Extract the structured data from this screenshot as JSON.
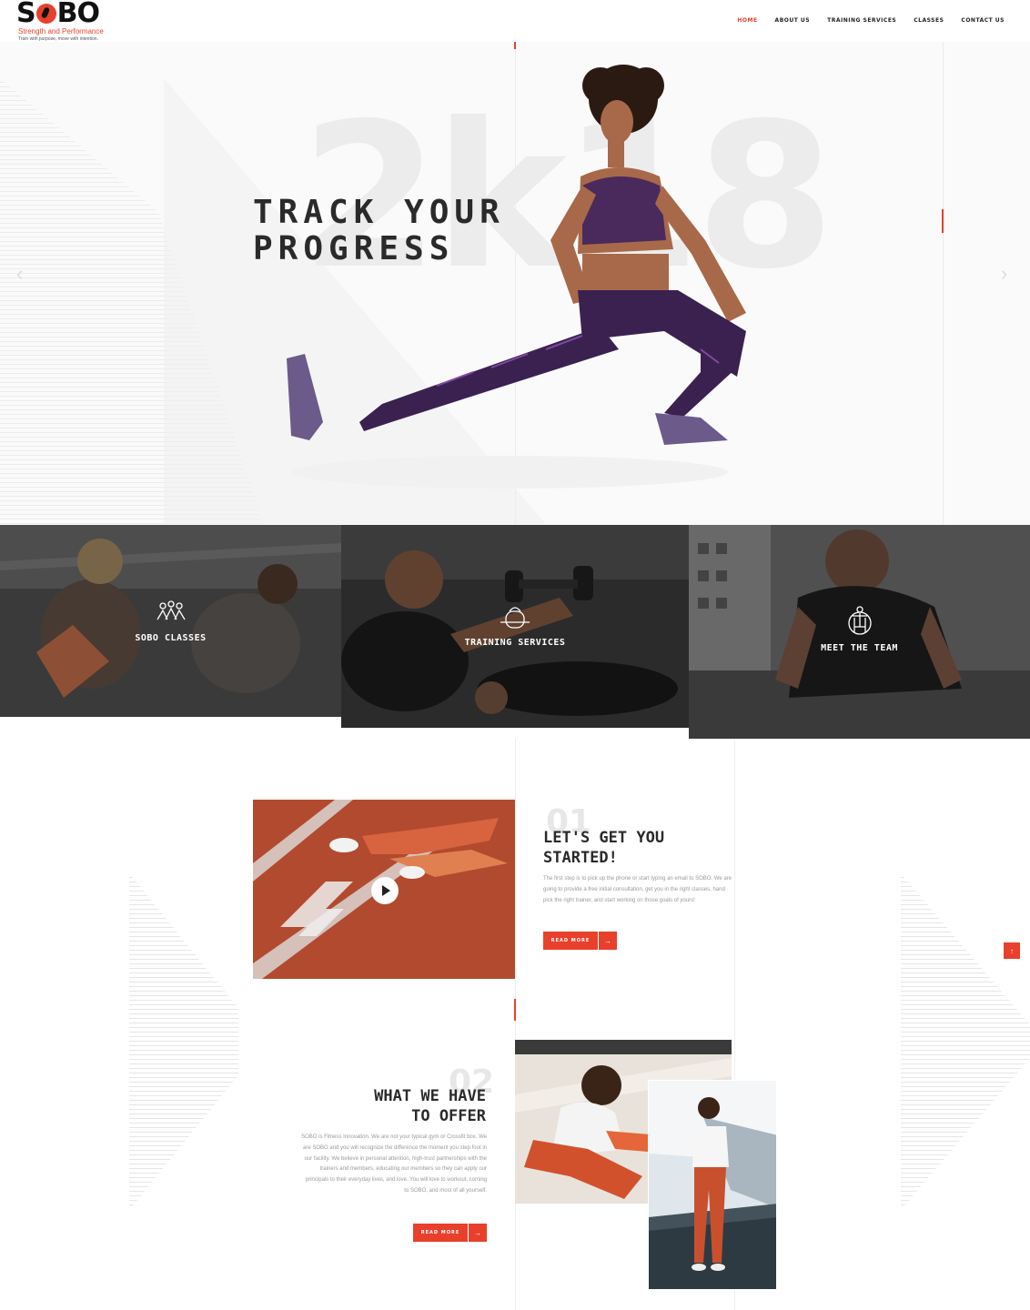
{
  "brand": {
    "name_left": "S",
    "name_right": "BO",
    "tagline": "Strength and Performance",
    "subtitle": "Train with purpose, move with intention."
  },
  "nav": {
    "items": [
      "HOME",
      "ABOUT US",
      "TRAINING SERVICES",
      "CLASSES",
      "CONTACT US"
    ],
    "active": "HOME"
  },
  "hero": {
    "watermark": "2k18",
    "title": "TRACK YOUR\nPROGRESS",
    "prev_icon": "chevron-left-icon",
    "next_icon": "chevron-right-icon"
  },
  "tiles": [
    {
      "label": "SOBO CLASSES",
      "icon": "group-people-icon"
    },
    {
      "label": "TRAINING SERVICES",
      "icon": "kettlebell-icon"
    },
    {
      "label": "MEET THE TEAM",
      "icon": "person-icon"
    }
  ],
  "section1": {
    "number": "01",
    "title": "LET'S GET YOU\nSTARTED!",
    "body": "The first step is to pick up the phone or start typing an email to SOBO. We are going to provide a free initial consultation, get you in the right classes, hand pick the right trainer, and start working on those goals of yours!",
    "button": "READ MORE",
    "video_icon": "play-icon"
  },
  "section2": {
    "number": "02",
    "title": "WHAT WE HAVE\nTO OFFER",
    "body": "SOBO is Fitness Innovation. We are not your typical gym or Crossfit box. We are SOBO and you will recognize the difference the moment you step foot in our facility. We believe in personal attention, high-trust partnerships with the trainers and members, educating our members so they can apply our principals to their everyday lives, and love. You will love to workout, coming to SOBO, and most of all yourself.",
    "button": "READ MORE"
  },
  "colors": {
    "accent": "#e8402b",
    "text_dark": "#2a2a2a",
    "muted": "#9a9a9a"
  }
}
